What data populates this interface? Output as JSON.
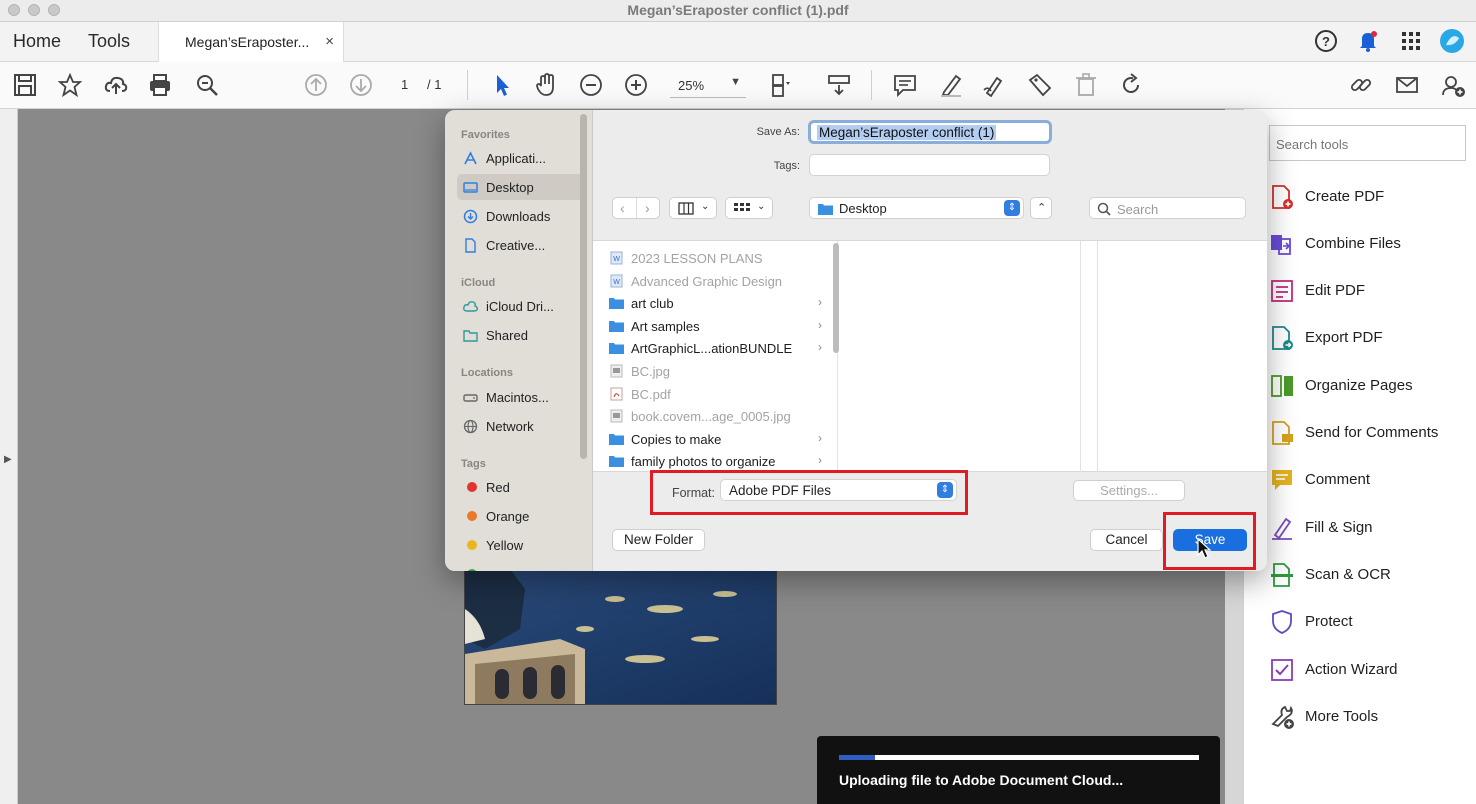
{
  "window": {
    "title": "Megan’sEraposter conflict (1).pdf"
  },
  "tabs": {
    "home": "Home",
    "tools": "Tools",
    "document": "Megan’sEraposter...",
    "close": "×"
  },
  "toolbar": {
    "page_current": "1",
    "page_total": "/ 1",
    "zoom": "25%"
  },
  "dialog": {
    "save_as_label": "Save As:",
    "save_as_value": "Megan’sEraposter conflict (1)",
    "tags_label": "Tags:",
    "location": "Desktop",
    "search_placeholder": "Search",
    "format_label": "Format:",
    "format_value": "Adobe PDF Files",
    "settings": "Settings...",
    "new_folder": "New Folder",
    "cancel": "Cancel",
    "save": "Save",
    "sidebar": {
      "favorites": "Favorites",
      "icloud": "iCloud",
      "locations": "Locations",
      "tags": "Tags",
      "items": {
        "applications": "Applicati...",
        "desktop": "Desktop",
        "downloads": "Downloads",
        "creative": "Creative...",
        "icloud_drive": "iCloud Dri...",
        "shared": "Shared",
        "macintosh": "Macintos...",
        "network": "Network",
        "red": "Red",
        "orange": "Orange",
        "yellow": "Yellow"
      }
    },
    "files": [
      {
        "name": "2023 LESSON PLANS",
        "dim": true,
        "type": "doc"
      },
      {
        "name": "Advanced Graphic Design",
        "dim": true,
        "type": "doc"
      },
      {
        "name": "art club",
        "dim": false,
        "type": "folder"
      },
      {
        "name": "Art samples",
        "dim": false,
        "type": "folder"
      },
      {
        "name": "ArtGraphicL...ationBUNDLE",
        "dim": false,
        "type": "folder"
      },
      {
        "name": "BC.jpg",
        "dim": true,
        "type": "image"
      },
      {
        "name": "BC.pdf",
        "dim": true,
        "type": "pdf"
      },
      {
        "name": "book.covem...age_0005.jpg",
        "dim": true,
        "type": "image"
      },
      {
        "name": "Copies to make",
        "dim": false,
        "type": "folder"
      },
      {
        "name": "family photos to organize",
        "dim": false,
        "type": "folder"
      }
    ]
  },
  "right_panel": {
    "search_placeholder": "Search tools",
    "tools": {
      "create_pdf": "Create PDF",
      "combine_files": "Combine Files",
      "edit_pdf": "Edit PDF",
      "export_pdf": "Export PDF",
      "organize_pages": "Organize Pages",
      "send_for_comments": "Send for Comments",
      "comment": "Comment",
      "fill_sign": "Fill & Sign",
      "scan_ocr": "Scan & OCR",
      "protect": "Protect",
      "action_wizard": "Action Wizard",
      "more_tools": "More Tools"
    }
  },
  "upload": {
    "message": "Uploading file to Adobe Document Cloud...",
    "progress": 0.1
  },
  "colors": {
    "accent": "#1a73e8",
    "highlight_red": "#e01b24",
    "folder_blue": "#3b8fe0"
  }
}
